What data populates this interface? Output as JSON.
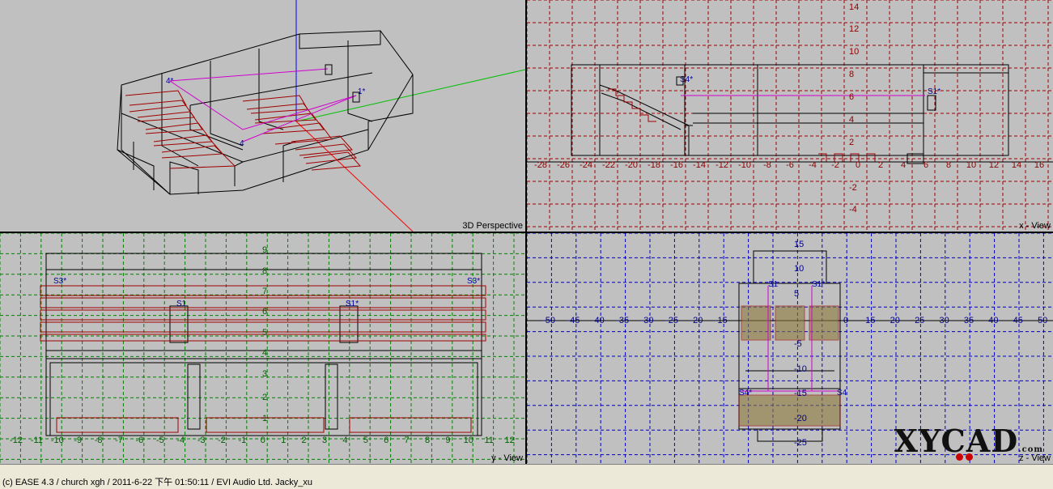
{
  "viewports": {
    "perspective": {
      "label": "3D Perspective"
    },
    "x_view": {
      "label": "x - View",
      "h_ticks": [
        "-28",
        "-26",
        "-24",
        "-22",
        "-20",
        "-18",
        "-16",
        "-14",
        "-12",
        "-10",
        "-8",
        "-6",
        "-4",
        "-2",
        "0",
        "2",
        "4",
        "6",
        "8",
        "10",
        "12",
        "14",
        "16"
      ],
      "v_ticks": [
        "14",
        "12",
        "10",
        "8",
        "6",
        "4",
        "2",
        "-2",
        "-4"
      ],
      "markers": [
        "S4*",
        "S1*"
      ]
    },
    "y_view": {
      "label": "y - View",
      "h_ticks": [
        "-12",
        "-11",
        "-10",
        "-9",
        "-8",
        "-7",
        "-6",
        "-5",
        "-4",
        "-3",
        "-2",
        "-1",
        "0",
        "1",
        "2",
        "3",
        "4",
        "5",
        "6",
        "7",
        "8",
        "9",
        "10",
        "11",
        "12"
      ],
      "v_ticks": [
        "9",
        "8",
        "7",
        "6",
        "5",
        "4",
        "3",
        "2",
        "1"
      ],
      "markers": [
        "S3*",
        "S3*",
        "S1",
        "S1*"
      ]
    },
    "z_view": {
      "label": "z - View",
      "h_ticks": [
        "-50",
        "-45",
        "-40",
        "-35",
        "-30",
        "-25",
        "-20",
        "-15",
        "0",
        "15",
        "20",
        "25",
        "30",
        "35",
        "40",
        "45",
        "50"
      ],
      "v_ticks": [
        "15",
        "10",
        "5",
        "-5",
        "-10",
        "-15",
        "-20",
        "-25"
      ],
      "markers": [
        "S1",
        "S1*",
        "S4*",
        "S4"
      ]
    }
  },
  "status_bar": {
    "text": "(c) EASE 4.3  / church xgh / 2011-6-22 下午 01:50:11 / EVI Audio Ltd. Jacky_xu"
  },
  "logo": {
    "text": "XYCAD",
    "suffix": ".com"
  },
  "colors": {
    "grid_x": "#a00000",
    "grid_y": "#008000",
    "grid_z": "#0000c0",
    "seat": "#a00000",
    "path": "#d000d0",
    "marker": "#0000a0"
  }
}
